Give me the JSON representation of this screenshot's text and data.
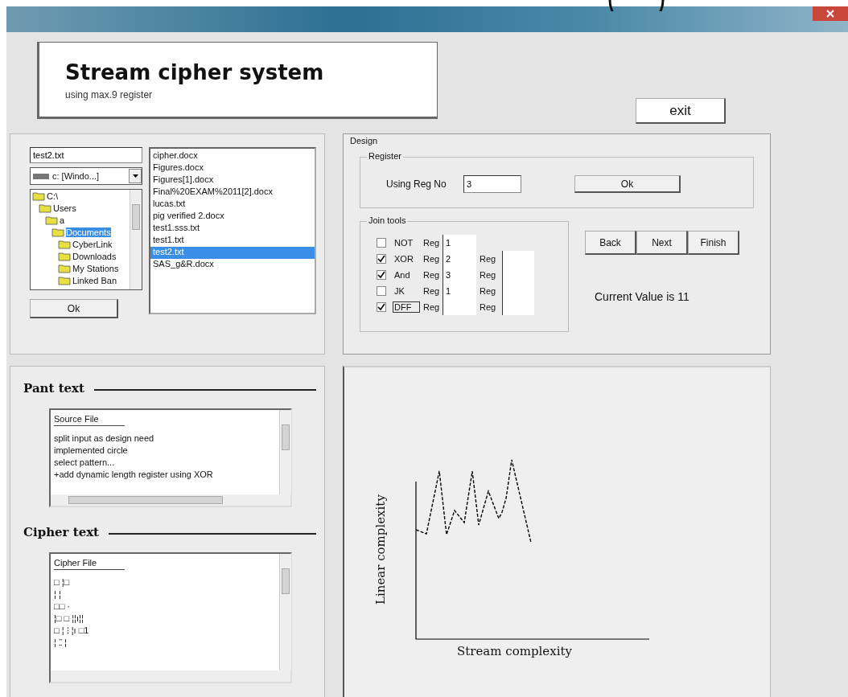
{
  "header": {
    "title": "Stream cipher system",
    "subtitle": "using max.9 register"
  },
  "exit_button": "exit",
  "file_picker": {
    "filename": "test2.txt",
    "drive": "c: [Windo...]",
    "folders": [
      {
        "name": "C:\\",
        "selected": false,
        "children": [
          {
            "name": "Users",
            "selected": false,
            "children": [
              {
                "name": "a",
                "selected": false,
                "children": [
                  {
                    "name": "Documents",
                    "selected": true,
                    "children": [
                      {
                        "name": "CyberLink",
                        "selected": false
                      },
                      {
                        "name": "Downloads",
                        "selected": false
                      },
                      {
                        "name": "My Stations",
                        "selected": false
                      },
                      {
                        "name": "Linked Ban",
                        "selected": false
                      }
                    ]
                  }
                ]
              }
            ]
          }
        ]
      }
    ],
    "files": [
      {
        "name": "cipher.docx",
        "selected": false
      },
      {
        "name": "Figures.docx",
        "selected": false
      },
      {
        "name": "Figures[1].docx",
        "selected": false
      },
      {
        "name": "Final%20EXAM%2011[2].docx",
        "selected": false
      },
      {
        "name": "lucas.txt",
        "selected": false
      },
      {
        "name": "pig verified 2.docx",
        "selected": false
      },
      {
        "name": "test1.sss.txt",
        "selected": false
      },
      {
        "name": "test1.txt",
        "selected": false
      },
      {
        "name": "test2.txt",
        "selected": true
      },
      {
        "name": "SAS_g&R.docx",
        "selected": false
      }
    ],
    "ok_button": "Ok"
  },
  "design": {
    "title": "Design",
    "register": {
      "title": "Register",
      "label": "Using Reg No",
      "value": "3",
      "ok_button": "Ok"
    },
    "join_tools": {
      "title": "Join tools",
      "rows": [
        {
          "checked": false,
          "focused": false,
          "label": "NOT",
          "reg_label": "Reg",
          "reg_value": "1"
        },
        {
          "checked": true,
          "focused": false,
          "label": "XOR",
          "reg_label": "Reg",
          "reg_value": "2",
          "reg2_label": "Reg"
        },
        {
          "checked": true,
          "focused": false,
          "label": "And",
          "reg_label": "Reg",
          "reg_value": "3",
          "reg2_label": "Reg"
        },
        {
          "checked": false,
          "focused": false,
          "label": "JK",
          "reg_label": "Reg",
          "reg_value": "1",
          "reg2_label": "Reg"
        },
        {
          "checked": true,
          "focused": true,
          "label": "DFF",
          "reg_label": "Reg",
          "reg2_label": "Reg"
        }
      ]
    },
    "nav_buttons": [
      "Back",
      "Next",
      "Finish"
    ],
    "current_value": "Current Value is 11"
  },
  "plain_text": {
    "heading": "Pant text",
    "lines": [
      "Source File",
      "split input as design need",
      "implemented circle",
      "select pattern...",
      "+add dynamic length register using XOR"
    ]
  },
  "cipher_text": {
    "heading": "Cipher text",
    "lines": [
      "Cipher File",
      "  □ ¦□",
      "¦ ¦",
      "□□ ·",
      "¦□ □ ¦¦ı¦¦",
      "□ ¦ ⁝ ¦ı □1",
      "¦  ⁚⁚ ¦"
    ]
  },
  "chart": {
    "xlabel": "Stream complexity",
    "ylabel": "Linear complexity"
  }
}
